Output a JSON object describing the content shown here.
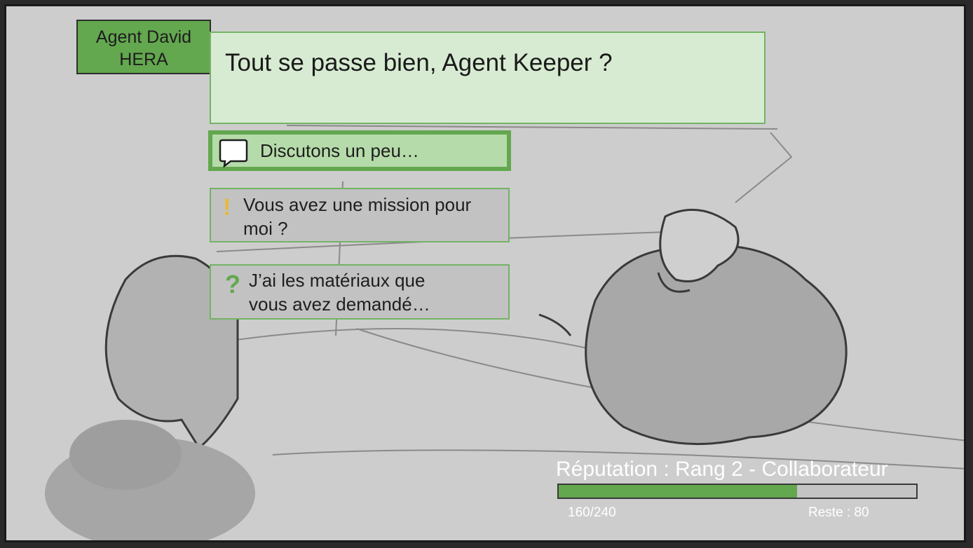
{
  "dialogue": {
    "speaker_line1": "Agent David",
    "speaker_line2": "HERA",
    "text": "Tout se passe bien, Agent Keeper ?"
  },
  "choices": [
    {
      "icon": "speech-bubble-icon",
      "line1": "Discutons un peu…",
      "line2": ""
    },
    {
      "icon": "exclamation-icon",
      "symbol": "!",
      "line1": "Vous avez une mission pour",
      "line2": "moi ?"
    },
    {
      "icon": "question-icon",
      "symbol": "?",
      "line1": "J’ai les matériaux que",
      "line2": "vous avez demandé…"
    }
  ],
  "reputation": {
    "title": "Réputation : Rang 2 - Collaborateur",
    "value_text": "160/240",
    "remaining_text": "Reste : 80",
    "progress": 0.6667
  },
  "colors": {
    "accent_green": "#63a74f",
    "light_green": "#d7ebd2",
    "choice_selected": "#b6dbaa",
    "choice_idle": "#c2c2c2",
    "exclamation": "#e7b93b"
  }
}
